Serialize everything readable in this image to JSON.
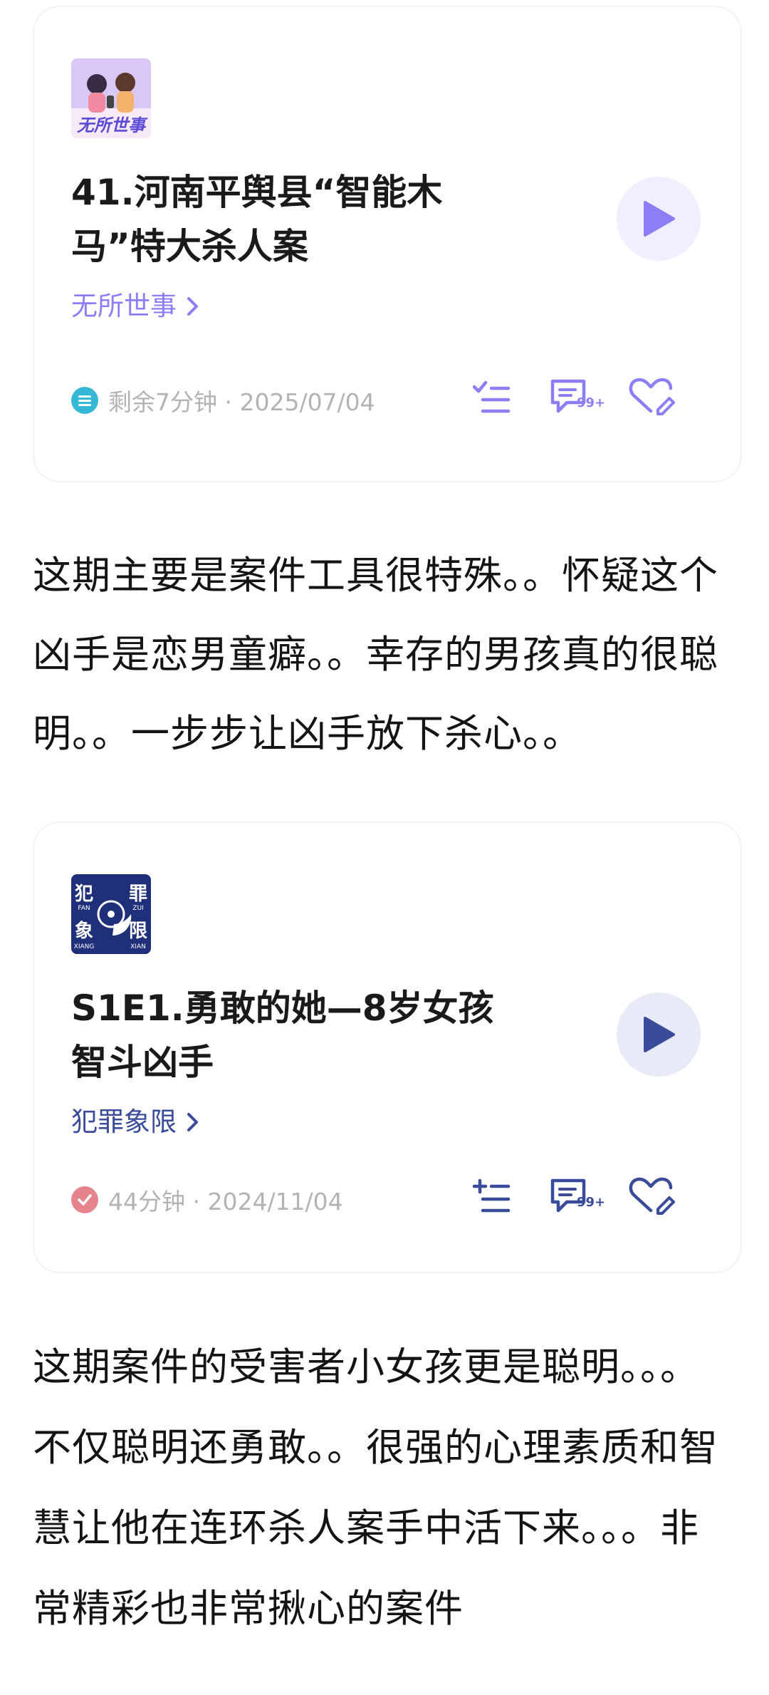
{
  "colors": {
    "purple_accent": "#8c7ff5",
    "purple_light_bg": "#f1efff",
    "navy_accent": "#3a4b9a",
    "navy_light_bg": "#e8ebf7",
    "teal_status": "#35b8d6",
    "pink_status": "#e6848d",
    "meta_gray": "#b3b3b3"
  },
  "card1": {
    "cover_text": "无所世事",
    "title": "41.河南平舆县“智能木马”特大杀人案",
    "podcast_name": "无所世事",
    "chevron_icon": "chevron-right-icon",
    "play_icon": "play-icon",
    "status_icon": "list-icon",
    "meta": "剩余7分钟 · 2025/07/04",
    "comment_badge": "99+",
    "actions": [
      "add-to-playlist-icon",
      "comment-icon",
      "favorite-icon"
    ]
  },
  "comment1": {
    "text": "这期主要是案件工具很特殊。。怀疑这个凶手是恋男童癖。。幸存的男孩真的很聪明。。一步步让凶手放下杀心。。"
  },
  "card2": {
    "cover_text": [
      "犯",
      "罪",
      "象",
      "限"
    ],
    "cover_pinyin": [
      "FAN",
      "ZUI",
      "XIANG",
      "XIAN"
    ],
    "title": "S1E1.勇敢的她—8岁女孩智斗凶手",
    "podcast_name": "犯罪象限",
    "chevron_icon": "chevron-right-icon",
    "play_icon": "play-icon",
    "status_icon": "check-icon",
    "meta": "44分钟 · 2024/11/04",
    "comment_badge": "99+",
    "actions": [
      "add-to-playlist-icon",
      "comment-icon",
      "favorite-icon"
    ]
  },
  "comment2": {
    "text": "这期案件的受害者小女孩更是聪明。。。不仅聪明还勇敢。。很强的心理素质和智慧让他在连环杀人案手中活下来。。。非常精彩也非常揪心的案件"
  }
}
